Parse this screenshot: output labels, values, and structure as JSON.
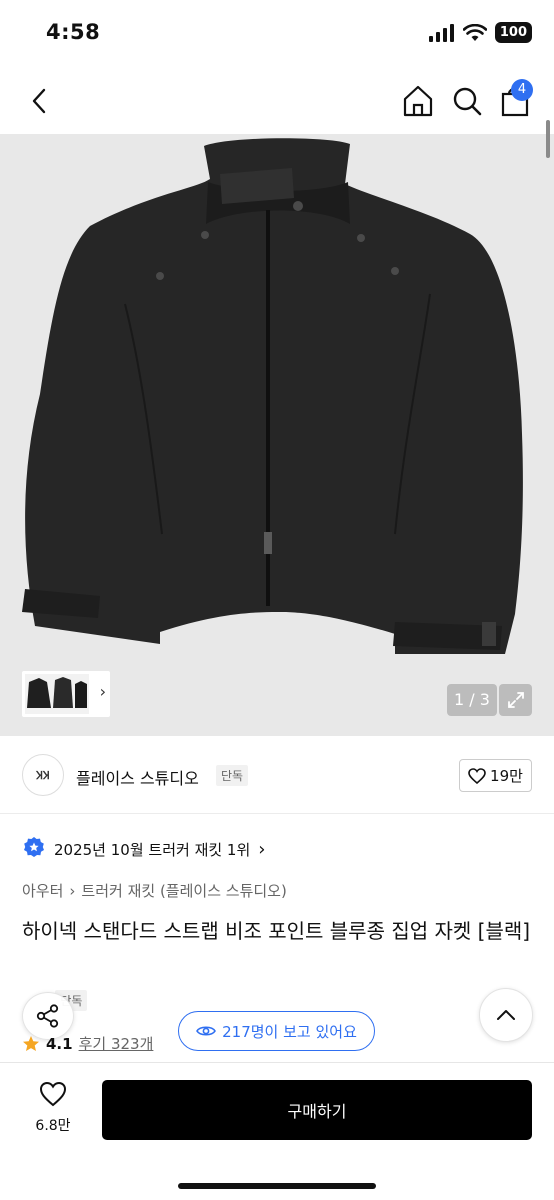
{
  "status": {
    "time": "4:58",
    "battery": "100"
  },
  "nav": {
    "cart_count": "4"
  },
  "gallery": {
    "page_indicator": "1 / 3"
  },
  "brand": {
    "logo_text": "ꞰꞰ",
    "name": "플레이스 스튜디오",
    "tag": "단독",
    "likes": "19만"
  },
  "ranking": {
    "text": "2025년 10월 트러커 재킷 1위"
  },
  "breadcrumb": {
    "level1": "아우터",
    "level2": "트러커 재킷 (플레이스 스튜디오)"
  },
  "product": {
    "title": "하이넥 스탠다드 스트랩 비조 포인트 블루종 집업 자켓 [블랙]",
    "exclusive_tag": "단독"
  },
  "rating": {
    "score": "4.1",
    "reviews": "후기 323개"
  },
  "viewers": {
    "text": "217명이 보고 있어요"
  },
  "bottom": {
    "wish_count": "6.8만",
    "buy_label": "구매하기"
  },
  "colors": {
    "accent": "#2f6ff1",
    "buy_button": "#000000",
    "star": "#f5a623"
  }
}
